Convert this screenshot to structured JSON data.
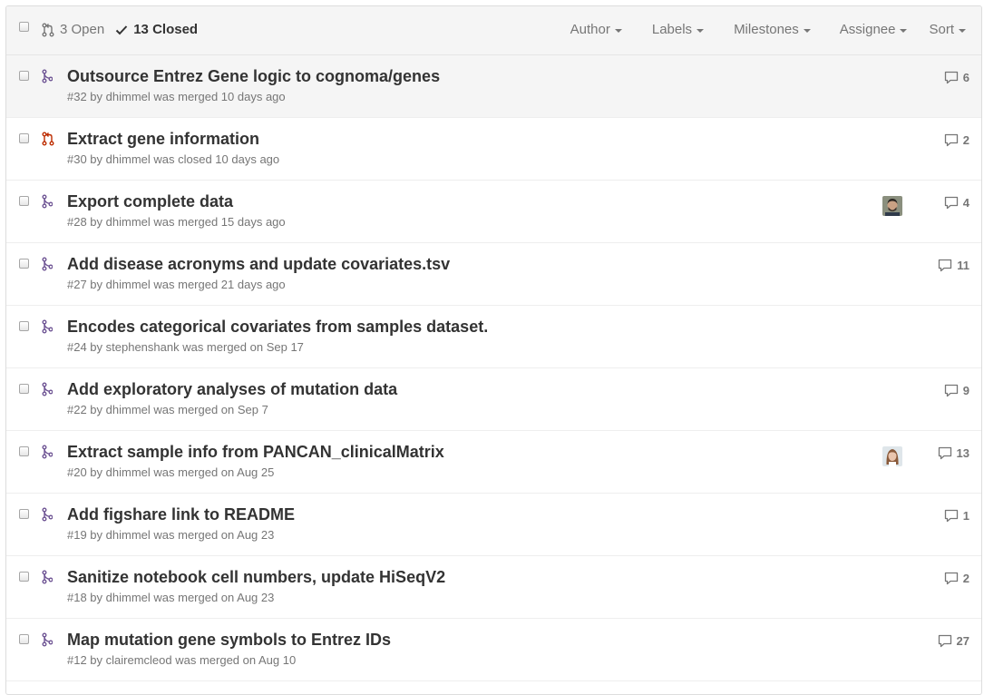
{
  "header": {
    "open_label": "3 Open",
    "closed_label": "13 Closed",
    "filters": [
      "Author",
      "Labels",
      "Milestones",
      "Assignee",
      "Sort"
    ]
  },
  "colors": {
    "merged": "#6e5494",
    "closed": "#bd2c00",
    "muted": "#767676",
    "text": "#333333"
  },
  "rows": [
    {
      "title": "Outsource Entrez Gene logic to cognoma/genes",
      "meta": "#32 by dhimmel was merged 10 days ago",
      "status": "merged",
      "comments": "6",
      "avatar": "",
      "hover": true
    },
    {
      "title": "Extract gene information",
      "meta": "#30 by dhimmel was closed 10 days ago",
      "status": "closed",
      "comments": "2",
      "avatar": ""
    },
    {
      "title": "Export complete data",
      "meta": "#28 by dhimmel was merged 15 days ago",
      "status": "merged",
      "comments": "4",
      "avatar": "man-avatar"
    },
    {
      "title": "Add disease acronyms and update covariates.tsv",
      "meta": "#27 by dhimmel was merged 21 days ago",
      "status": "merged",
      "comments": "11",
      "avatar": ""
    },
    {
      "title": "Encodes categorical covariates from samples dataset.",
      "meta": "#24 by stephenshank was merged on Sep 17",
      "status": "merged",
      "comments": "",
      "avatar": ""
    },
    {
      "title": "Add exploratory analyses of mutation data",
      "meta": "#22 by dhimmel was merged on Sep 7",
      "status": "merged",
      "comments": "9",
      "avatar": ""
    },
    {
      "title": "Extract sample info from PANCAN_clinicalMatrix",
      "meta": "#20 by dhimmel was merged on Aug 25",
      "status": "merged",
      "comments": "13",
      "avatar": "woman-avatar"
    },
    {
      "title": "Add figshare link to README",
      "meta": "#19 by dhimmel was merged on Aug 23",
      "status": "merged",
      "comments": "1",
      "avatar": ""
    },
    {
      "title": "Sanitize notebook cell numbers, update HiSeqV2",
      "meta": "#18 by dhimmel was merged on Aug 23",
      "status": "merged",
      "comments": "2",
      "avatar": ""
    },
    {
      "title": "Map mutation gene symbols to Entrez IDs",
      "meta": "#12 by clairemcleod was merged on Aug 10",
      "status": "merged",
      "comments": "27",
      "avatar": ""
    }
  ]
}
